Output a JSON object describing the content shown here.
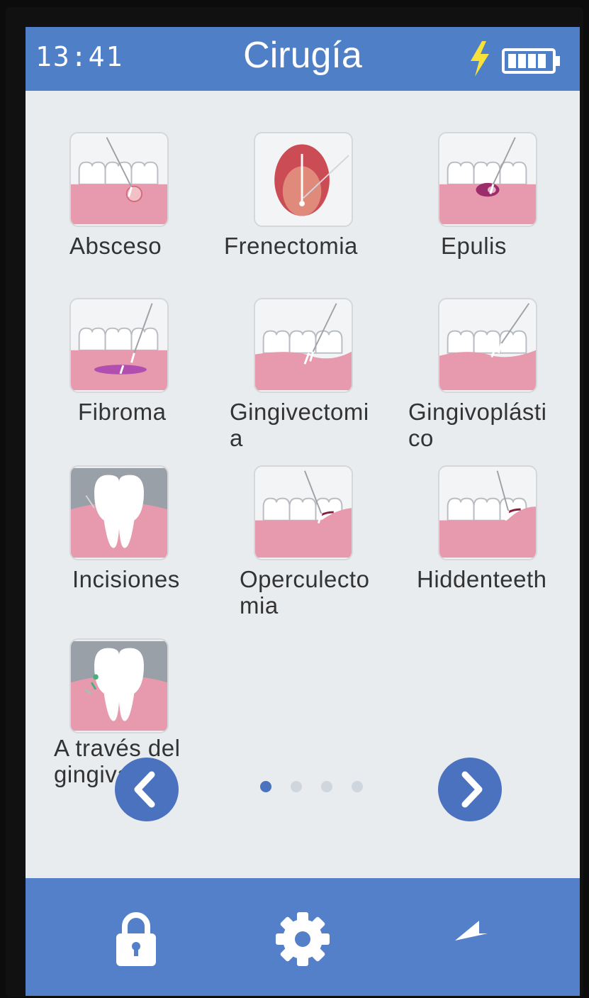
{
  "status": {
    "time": "13:41",
    "title": "Cirugía",
    "charging_icon": "lightning-bolt-icon",
    "battery_icon": "battery-full-icon"
  },
  "procedures": [
    {
      "label": "Absceso",
      "icon": "abscess-icon"
    },
    {
      "label": "Frenectomia",
      "icon": "frenectomy-icon"
    },
    {
      "label": "Epulis",
      "icon": "epulis-icon"
    },
    {
      "label": "Fibroma",
      "icon": "fibroma-icon"
    },
    {
      "label": "Gingivectomi\na",
      "icon": "gingivectomy-icon"
    },
    {
      "label": "Gingivoplásti\nco",
      "icon": "gingivoplasty-icon"
    },
    {
      "label": "Incisiones",
      "icon": "incision-icon"
    },
    {
      "label": "Operculecto\nmia",
      "icon": "operculectomy-icon"
    },
    {
      "label": "Hiddenteeth",
      "icon": "hidden-teeth-icon"
    },
    {
      "label": "A través del\ngingival",
      "icon": "transgingival-icon"
    }
  ],
  "pagination": {
    "prev_icon": "chevron-left-icon",
    "next_icon": "chevron-right-icon",
    "page_count": 4,
    "current_page": 1
  },
  "bottom_bar": {
    "lock_icon": "lock-icon",
    "settings_icon": "gear-icon",
    "back_icon": "back-arrow-icon"
  },
  "colors": {
    "header": "#4f7fc6",
    "bottom_bar": "#5480c9",
    "nav_button": "#4a72bf",
    "gum": "#e79aad",
    "screen_background": "#e9ecef",
    "active_dot": "#4a72bf",
    "inactive_dot": "#cfd6de"
  }
}
